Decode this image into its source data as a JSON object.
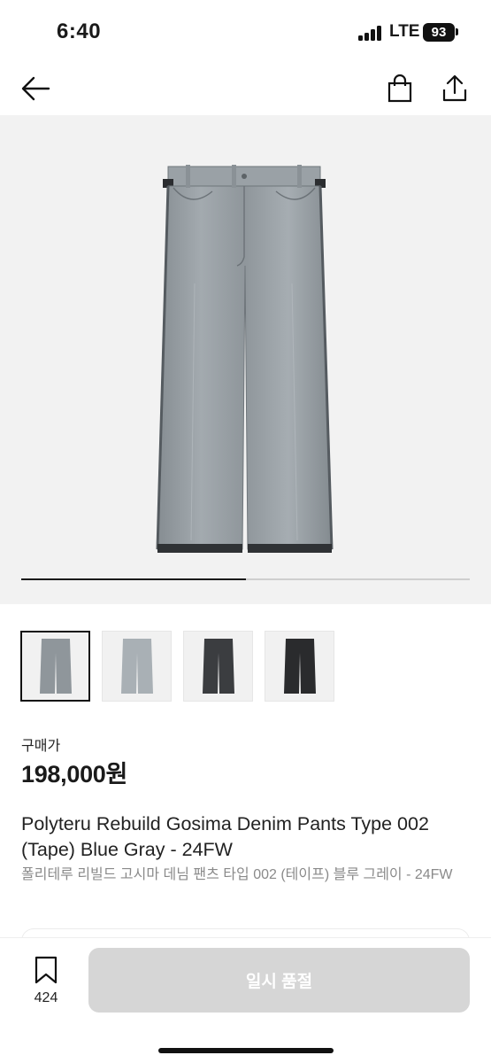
{
  "status": {
    "time": "6:40",
    "network": "LTE",
    "battery": "93"
  },
  "nav": {
    "back_icon": "arrow-left-icon",
    "bag_icon": "shopping-bag-icon",
    "share_icon": "share-icon"
  },
  "gallery": {
    "progress": 0.5,
    "thumbnails": [
      {
        "name": "thumb-front-blue-gray",
        "color": "#8f969b",
        "active": true
      },
      {
        "name": "thumb-front-light",
        "color": "#a9b0b5",
        "active": false
      },
      {
        "name": "thumb-front-charcoal",
        "color": "#3b3d40",
        "active": false
      },
      {
        "name": "thumb-front-black",
        "color": "#2a2b2d",
        "active": false
      }
    ]
  },
  "product": {
    "price_label": "구매가",
    "price": "198,000원",
    "title_en": "Polyteru Rebuild Gosima Denim Pants Type 002 (Tape) Blue Gray - 24FW",
    "title_ko": "폴리테루 리빌드 고시마 데님 팬츠 타입 002 (테이프) 블루 그레이 - 24FW"
  },
  "footer": {
    "wish_icon": "bookmark-icon",
    "wish_count": "424",
    "action_label": "일시 품절",
    "action_color": "#d6d6d6"
  }
}
